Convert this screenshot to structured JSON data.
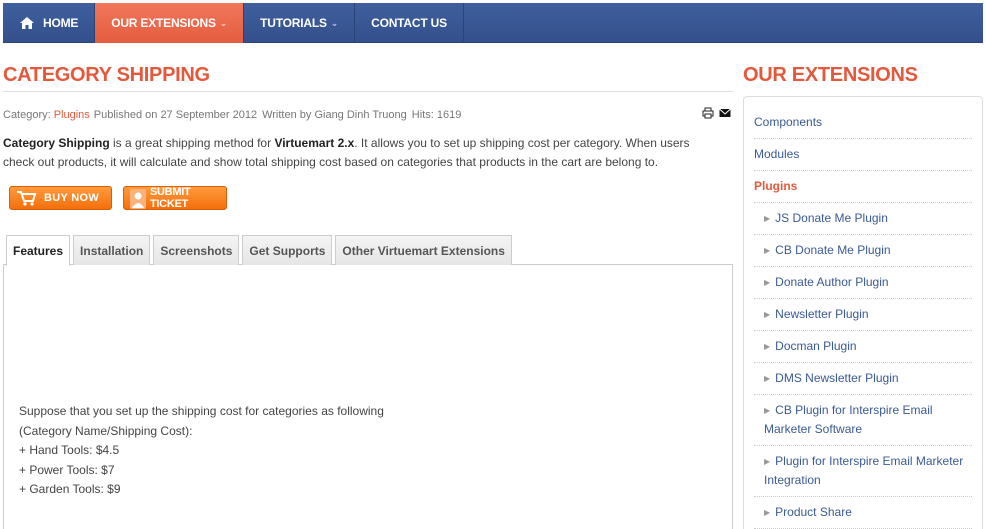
{
  "nav": {
    "items": [
      {
        "label": "HOME",
        "icon": "home-icon"
      },
      {
        "label": "OUR EXTENSIONS",
        "active": true,
        "has_dropdown": true
      },
      {
        "label": "TUTORIALS",
        "has_dropdown": true
      },
      {
        "label": "CONTACT US"
      }
    ]
  },
  "article": {
    "title": "CATEGORY SHIPPING",
    "category_label": "Category:",
    "category_link": "Plugins",
    "published": "Published on 27 September 2012",
    "author": "Written by Giang Dinh Truong",
    "hits": "Hits: 1619",
    "intro_bold1": "Category Shipping",
    "intro_part1": " is a great shipping method for ",
    "intro_bold2": "Virtuemart 2.x",
    "intro_part2": ". It allows you to set up shipping cost per category. When users check out products, it will calculate and show total shipping cost based on categories that products in the cart are belong to.",
    "buy_label": "BUY NOW",
    "ticket_label": "SUBMIT TICKET",
    "tabs": [
      {
        "label": "Features",
        "active": true
      },
      {
        "label": "Installation"
      },
      {
        "label": "Screenshots"
      },
      {
        "label": "Get Supports"
      },
      {
        "label": "Other Virtuemart Extensions"
      }
    ],
    "panel_lines": [
      "Suppose that you set up the shipping cost for categories as following",
      "(Category Name/Shipping Cost):",
      "+ Hand Tools: $4.5",
      "+ Power Tools: $7",
      "+ Garden Tools: $9"
    ]
  },
  "sidebar": {
    "title": "OUR EXTENSIONS",
    "items": [
      {
        "label": "Components"
      },
      {
        "label": "Modules"
      },
      {
        "label": "Plugins",
        "active": true
      },
      {
        "label": "JS Donate Me Plugin",
        "sub": true
      },
      {
        "label": "CB Donate Me Plugin",
        "sub": true
      },
      {
        "label": "Donate Author Plugin",
        "sub": true
      },
      {
        "label": "Newsletter Plugin",
        "sub": true
      },
      {
        "label": "Docman Plugin",
        "sub": true
      },
      {
        "label": "DMS Newsletter Plugin",
        "sub": true
      },
      {
        "label": "CB Plugin for Interspire Email Marketer Software",
        "sub": true
      },
      {
        "label": "Plugin for Interspire Email Marketer Integration",
        "sub": true
      },
      {
        "label": "Product Share",
        "sub": true
      }
    ]
  },
  "colors": {
    "accent": "#e4593c",
    "nav_bg": "#3b5998",
    "link": "#3a5a95",
    "button": "#f46f0c"
  }
}
